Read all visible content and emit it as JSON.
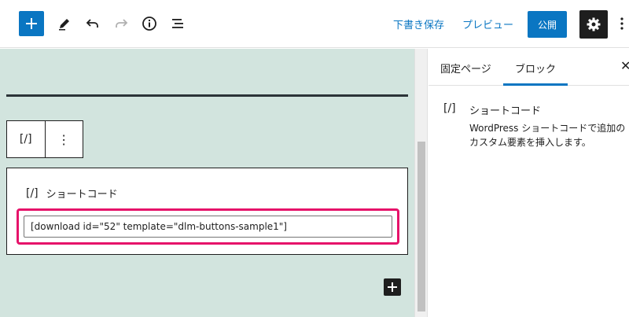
{
  "toolbar": {
    "save_draft_label": "下書き保存",
    "preview_label": "プレビュー",
    "publish_label": "公開"
  },
  "colors": {
    "accent": "#0a76c2",
    "canvas_bg": "#d2e4de",
    "highlight": "#e6136a",
    "dark": "#1e1e1e"
  },
  "block_toolbar": {
    "shortcode_icon": "[/]",
    "more_icon": "⋮"
  },
  "shortcode_block": {
    "icon": "[/]",
    "label": "ショートコード",
    "value": "[download id=\"52\" template=\"dlm-buttons-sample1\"]"
  },
  "sidebar": {
    "tabs": [
      {
        "label": "固定ページ"
      },
      {
        "label": "ブロック"
      }
    ],
    "close_icon": "✕",
    "block_card": {
      "icon": "[/]",
      "title": "ショートコード",
      "description_line1": "WordPress ショートコードで追加の",
      "description_line2": "カスタム要素を挿入します。"
    }
  }
}
